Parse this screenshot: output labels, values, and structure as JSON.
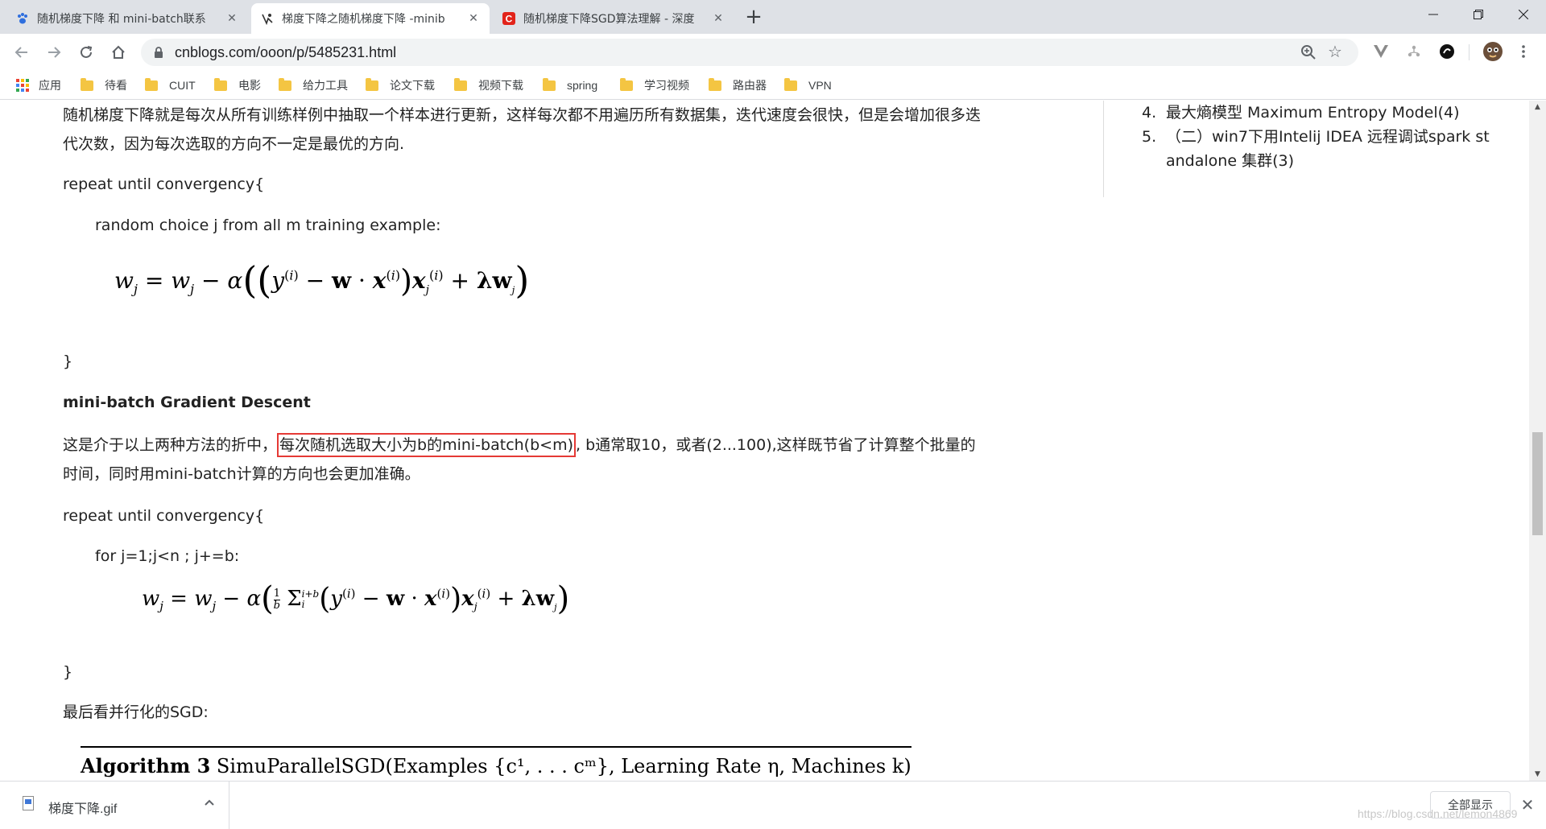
{
  "browser": {
    "tabs": [
      {
        "title": "随机梯度下降 和 mini-batch联系"
      },
      {
        "title": "梯度下降之随机梯度下降 -minib"
      },
      {
        "title": "随机梯度下降SGD算法理解 - 深度"
      }
    ],
    "url": "cnblogs.com/ooon/p/5485231.html",
    "bookmarks": [
      {
        "label": "应用"
      },
      {
        "label": "待看"
      },
      {
        "label": "CUIT"
      },
      {
        "label": "电影"
      },
      {
        "label": "给力工具"
      },
      {
        "label": "论文下载"
      },
      {
        "label": "视频下载"
      },
      {
        "label": "spring"
      },
      {
        "label": "学习视频"
      },
      {
        "label": "路由器"
      },
      {
        "label": "VPN"
      }
    ]
  },
  "article": {
    "sgd_para_line1": "随机梯度下降就是每次从所有训练样例中抽取一个样本进行更新，这样每次都不用遍历所有数据集，迭代速度会很快，但是会增加很多迭",
    "sgd_para_line2": "代次数，因为每次选取的方向不一定是最优的方向.",
    "repeat1": "repeat until convergency{",
    "random_choice": "random choice j from all m training example:",
    "close1": "}",
    "minibatch_heading": "mini-batch Gradient Descent",
    "mb_para_pre": "这是介于以上两种方法的折中，",
    "mb_para_highlight": "每次随机选取大小为b的mini-batch(b<m)",
    "mb_para_post": ", b通常取10，或者(2...100),这样既节省了计算整个批量的",
    "mb_para_line2": "时间，同时用mini-batch计算的方向也会更加准确。",
    "repeat2": "repeat until convergency{",
    "for_loop": "for j=1;j<n ; j+=b:",
    "close2": "}",
    "parallel_text": "最后看并行化的SGD:",
    "algo_title_bold": "Algorithm 3",
    "algo_title_rest": "SimuParallelSGD(Examples {c¹, . . . cᵐ}, Learning Rate η, Machines k)"
  },
  "sidebar": {
    "items": [
      {
        "num": "4.",
        "text": "最大熵模型 Maximum Entropy Model(4)"
      },
      {
        "num": "5.",
        "text": "（二）win7下用Intelij IDEA 远程调试spark st"
      },
      {
        "num": "",
        "text": "andalone 集群(3)"
      }
    ]
  },
  "downloads": {
    "filename": "梯度下降.gif",
    "show_all": "全部显示"
  },
  "watermark": "https://blog.csdn.net/lemon4869"
}
